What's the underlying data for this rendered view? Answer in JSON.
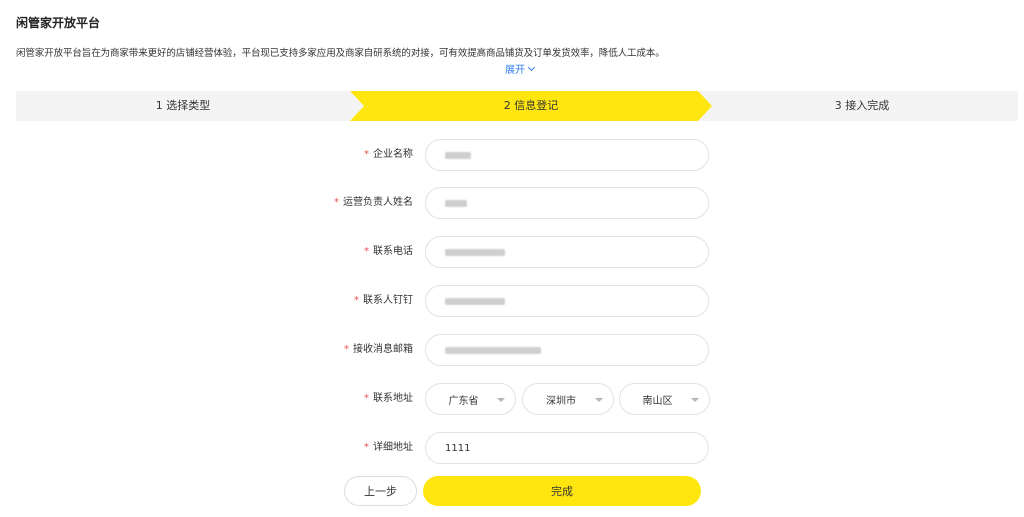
{
  "header": {
    "title": "闲管家开放平台",
    "description": "闲管家开放平台旨在为商家带来更好的店铺经营体验，平台现已支持多家应用及商家自研系统的对接，可有效提高商品铺货及订单发货效率，降低人工成本。",
    "expand_label": "展开"
  },
  "steps": [
    {
      "label": "1 选择类型"
    },
    {
      "label": "2 信息登记"
    },
    {
      "label": "3 接入完成"
    }
  ],
  "active_step": 2,
  "form": {
    "required_mark": "*",
    "company_name": {
      "label": "企业名称",
      "value": ""
    },
    "operator_name": {
      "label": "运营负责人姓名",
      "value": ""
    },
    "phone": {
      "label": "联系电话",
      "value": ""
    },
    "dingtalk": {
      "label": "联系人钉钉",
      "value": ""
    },
    "email": {
      "label": "接收消息邮箱",
      "value": ""
    },
    "address": {
      "label": "联系地址",
      "province": "广东省",
      "city": "深圳市",
      "district": "南山区"
    },
    "detail_address": {
      "label": "详细地址",
      "value": "1111"
    }
  },
  "actions": {
    "prev_label": "上一步",
    "done_label": "完成"
  },
  "colors": {
    "accent": "#ffe60f",
    "link": "#2f7ef5",
    "required": "#f04d4d",
    "step_bg": "#f4f4f4"
  }
}
